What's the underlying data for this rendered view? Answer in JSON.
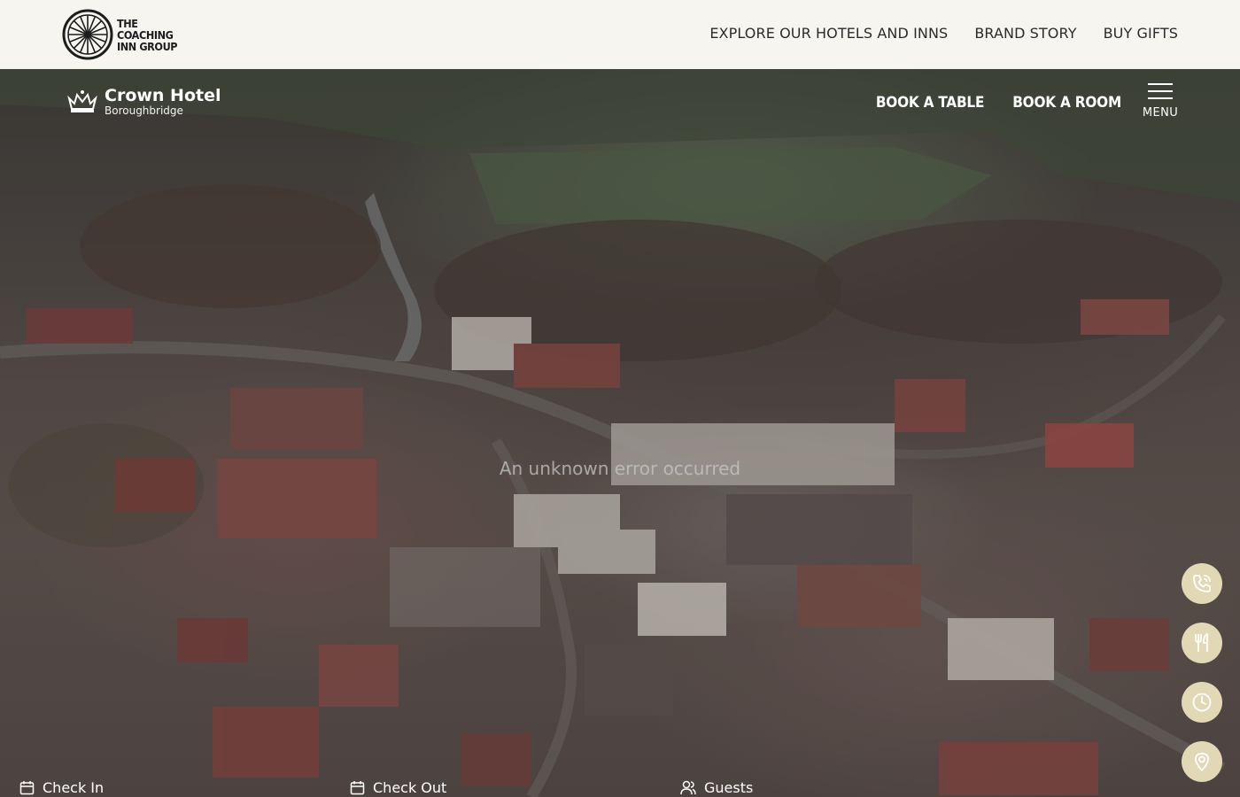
{
  "group": {
    "logo_text": "THE COACHING INN GROUP",
    "nav": [
      "EXPLORE OUR HOTELS AND INNS",
      "BRAND STORY",
      "BUY GIFTS"
    ]
  },
  "hotel": {
    "name": "Crown Hotel",
    "place": "Boroughbridge",
    "nav": {
      "book_table": "BOOK A TABLE",
      "book_room": "BOOK A ROOM",
      "menu": "MENU"
    }
  },
  "hero": {
    "error_message": "An unknown error occurred"
  },
  "side_actions": [
    {
      "icon": "phone-icon"
    },
    {
      "icon": "cutlery-icon"
    },
    {
      "icon": "clock-icon"
    },
    {
      "icon": "location-pin-icon"
    }
  ],
  "booking": {
    "check_in": "Check In",
    "check_out": "Check Out",
    "guests": "Guests"
  },
  "colors": {
    "topbar_bg": "#f6f5f0",
    "action_circle": "#e3d8b5",
    "hero_text": "#ffffff"
  }
}
